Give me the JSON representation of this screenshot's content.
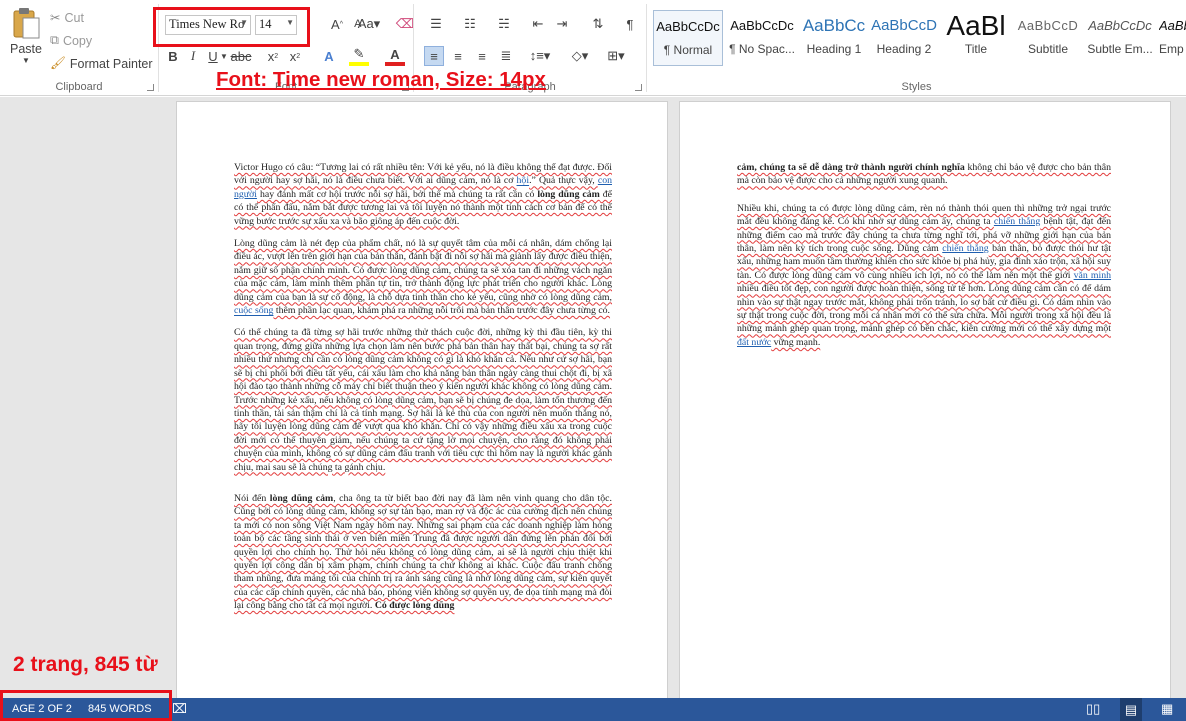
{
  "clipboard": {
    "paste": "Paste",
    "cut": "Cut",
    "copy": "Copy",
    "format_painter": "Format Painter",
    "group": "Clipboard"
  },
  "font": {
    "name": "Times New Ro",
    "size": "14",
    "group": "Font"
  },
  "paragraph": {
    "group": "Paragraph"
  },
  "styles": {
    "group": "Styles",
    "items": [
      {
        "preview": "AaBbCcDc",
        "name": "¶ Normal"
      },
      {
        "preview": "AaBbCcDc",
        "name": "¶ No Spac..."
      },
      {
        "preview": "AaBbCc",
        "name": "Heading 1"
      },
      {
        "preview": "AaBbCcD",
        "name": "Heading 2"
      },
      {
        "preview": "AaBl",
        "name": "Title"
      },
      {
        "preview": "AaBbCcD",
        "name": "Subtitle"
      },
      {
        "preview": "AaBbCcDc",
        "name": "Subtle Em..."
      },
      {
        "preview": "AaBbCcDc",
        "name": "Emp"
      }
    ]
  },
  "annotations": {
    "font_note": "Font: Time new roman, Size: 14px",
    "count_note": "2 trang, 845 từ"
  },
  "colors": {
    "accent": "#2b579a",
    "annotation": "#e8101a",
    "link": "#1f5fb0"
  },
  "page1": {
    "p1": [
      "Victor Hugo có câu: “Tương lai có rất nhiều tên: Với kẻ yếu, nó là điều không thể đạt được. Đối với người hay sợ hãi, nó là điều chưa biết. Với ai dũng cảm, nó là cơ ",
      "hội",
      ".” Quả thực vậy, ",
      "con người",
      " hay đánh mất cơ hội trước nỗi sợ hãi, bởi thế mà chúng ta rất cần có ",
      "lòng dũng cảm",
      " để có thể phấn đấu, nắm bắt được tương lai và tôi luyện nó thành một tính cách cơ bản để có thể vững bước trước sự xấu xa và bão giông áp đến cuộc đời."
    ],
    "p2": [
      "Lòng dũng cảm là nét đẹp của phẩm chất, nó là sự quyết tâm của mỗi cá nhân, dám chống lại điều ác, vượt lên trên giới hạn của bản thân, đánh bật đi nỗi sợ hãi mà giành lấy được điều thiện, nắm giữ số phận chính mình. Có được lòng dũng cảm, chúng ta sẽ xóa tan đi những vách ngăn của mặc cảm, làm mình thêm phần tự tin, trở thành động lực phát triển cho người khác. Lòng dũng cảm của bạn là sự cổ động, là chỗ dựa tinh thần cho kẻ yếu, cũng nhờ có lòng dũng cảm, ",
      "cuộc sống",
      " thêm phần lạc quan, khám phá ra những nỗi trôi mà bản thân trước đây chưa từng có."
    ],
    "p3": "Có thể chúng ta đã từng sợ hãi trước những thử thách cuộc đời, những kỳ thi đầu tiên, kỳ thi quan trọng, đứng giữa những lựa chọn làm nên bước phá bản thân hay thất bại, chúng ta sợ rất nhiều thứ nhưng chỉ cần có lòng dũng cảm không có gì là khó khăn cả. Nếu như cứ sợ hãi, bạn sẽ bị chi phối bởi điều tất yếu, cái xấu làm cho khả năng bản thân ngày càng thui chột đi, bị xã hội đào tạo thành những cỗ máy chỉ biết thuận theo ý kiến người khác không có lòng dũng cảm. Trước những kẻ xấu, nếu không có lòng dũng cảm, bạn sẽ bị chúng đe dọa, làm tổn thương đến tinh thần, tài sản thậm chí là cả tính mạng. Sợ hãi là kẻ thù của con người nên muốn thắng nó, hãy tôi luyện lòng dũng cảm để vượt qua khó khăn. Chỉ có vậy những điều xấu xa trong cuộc đời mới có thể thuyên giảm, nếu chúng ta cứ tặng lờ mọi chuyện, cho rằng đó không phải chuyện của mình, không có sự dũng cảm đấu tranh với tiêu cực thì hôm nay là người khác gánh chịu, mai sau sẽ là chúng ta gánh chịu.",
    "p4": [
      "Nói đến ",
      "lòng dũng cảm",
      ", cha ông ta từ biết bao đời nay đã làm nên vinh quang cho dân tộc. Cũng bởi có lòng dũng cảm, không sợ sự tàn bạo, man rợ và độc ác của cường địch nên chúng ta mới có non sông Việt Nam ngày hôm nay. Những sai phạm của các doanh nghiệp làm hỏng toàn bộ các tầng sinh thái ở ven biển miền Trung đã được người dân đứng lên phản đối bởi quyền lợi cho chính họ. Thử hỏi nếu không có lòng dũng cảm, ai sẽ là người chịu thiệt khi quyền lợi công dân bị xâm phạm, chính chúng ta chứ không ai khác. Cuộc đấu tranh chống tham nhũng, đưa mảng tối của chính trị ra ánh sáng cũng là nhờ lòng dũng cảm, sự kiên quyết của các cấp chính quyền, các nhà báo, phóng viên không sợ quyền uy, đe dọa tính mạng mà đòi lại công bằng cho tất cả mọi người. ",
      "Có được lòng dũng"
    ]
  },
  "page2": {
    "p1": [
      "cảm, chúng ta sẽ dễ dàng trở thành người chính nghĩa",
      " không chỉ bảo vệ được cho bản thân mà còn bảo vệ được cho cả những người xung quanh."
    ],
    "p2": [
      "Nhiều khi, chúng ta có được lòng dũng cảm, rèn nó thành thói quen thì những trở ngại trước mắt đều không đáng kể. Có khi nhờ sự dũng cảm ấy, chúng ta ",
      "chiến thắng",
      " bệnh tật, đạt đến những điểm cao mà trước đây chúng ta chưa từng nghĩ tới, phá vỡ những giới hạn của bản thân, làm nên kỳ tích trong cuộc sống. Dũng cảm ",
      "chiến thắng",
      " bản thân, bỏ được thói hư tật xấu, những ham muốn tầm thường khiến cho sức khỏe bị phá hủy, gia đình xáo trộn, xã hội suy tàn. Có được lòng dũng cảm vô cùng nhiều ích lợi, nó có thể làm nên một thế giới ",
      "văn minh",
      " nhiều điều tốt đẹp, con người được hoàn thiện, sống tử tế hơn. Lòng dũng cảm cần có để dám nhìn vào sự thật ngay trước mắt, không phải trốn tránh, lo sợ bất cứ điều gì. Có dám nhìn vào sự thật trong cuộc đời, trong mỗi cá nhân mới có thể sửa chữa. Mỗi người trong xã hội đều là những mảnh ghép quan trọng, mảnh ghép có bền chắc, kiên cường mới có thể xây dựng một ",
      "đất nước",
      " vững mạnh."
    ]
  },
  "status": {
    "page": "AGE 2 OF 2",
    "words": "845 WORDS"
  }
}
